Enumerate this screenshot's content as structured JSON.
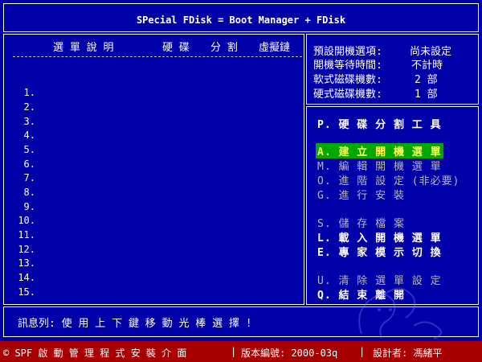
{
  "window": {
    "title": "SPecial FDisk = Boot Manager + FDisk"
  },
  "left_panel": {
    "headers": [
      "選 單 說 明",
      "硬 碟",
      "分 割",
      "虛擬鏈"
    ],
    "entries": [
      "1.",
      "2.",
      "3.",
      "4.",
      "5.",
      "6.",
      "7.",
      "8.",
      "9.",
      "10.",
      "11.",
      "12.",
      "13.",
      "14.",
      "15."
    ]
  },
  "info_panel": {
    "default_boot_label": "預設開機選項:",
    "default_boot_value": "尚未設定",
    "wait_time_label": "開機等待時間:",
    "wait_time_value": "不計時",
    "floppy_label": "軟式磁碟機數:",
    "floppy_value": "2 部",
    "hdd_label": "硬式磁碟機數:",
    "hdd_value": "1 部"
  },
  "menu": {
    "partition_tool": "P. 硬 碟 分 割 工 具",
    "create_boot_menu": "A. 建 立 開 機 選 單",
    "edit_boot_menu": "M. 編 輯 開 機 選 單",
    "advanced_settings": "O. 進 階 設 定 (非必要)",
    "install": "G. 進 行 安 裝",
    "save_file": "S. 儲 存 檔 案",
    "load_boot_menu": "L. 載 入 開 機 選 單",
    "expert_mode": "E. 專 家 模 示 切 換",
    "clear_menu": "U. 清 除 選 單 設 定",
    "exit": "Q. 結 束 離 開"
  },
  "status": {
    "message": "訊息列: 使 用 上 下 鍵 移 動 光 棒 選 擇 !"
  },
  "footer": {
    "product": "© SPF 啟 動 管 理 程 式 安 裝 介 面",
    "version": "版本編號: 2000-03q",
    "author": "設計者: 馮緒平"
  },
  "colors": {
    "background": "#0000a8",
    "highlight_bg": "#00a800",
    "highlight_fg": "#ffff55",
    "footer_bg": "#a80000",
    "dim_text": "#b8b8b8"
  }
}
